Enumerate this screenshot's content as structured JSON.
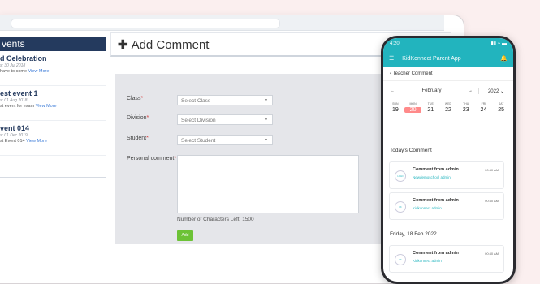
{
  "events": {
    "header": "vents",
    "items": [
      {
        "title": "d Celebration",
        "date": "s: 30 Jul 2018",
        "desc": "have to come",
        "more": "View More"
      },
      {
        "title": "est event 1",
        "date": "s: 01 Aug 2018",
        "desc": "st event for exam",
        "more": "View More"
      },
      {
        "title": "vent 014",
        "date": "s: 01 Dec 2019",
        "desc": "st Event 014",
        "more": "View More"
      }
    ]
  },
  "add_comment": {
    "title": "Add Comment",
    "fields": {
      "class_label": "Class",
      "class_value": "Select Class",
      "division_label": "Division",
      "division_value": "Select Division",
      "student_label": "Student",
      "student_value": "Select Student",
      "comment_label": "Personal comment"
    },
    "chars_left": "Number of Characters Left: 1500",
    "add_label": "Add"
  },
  "phone": {
    "time": "4:20",
    "signal": "▮▮ ⌁ ▬",
    "app_title": "KidKonnect Parent App",
    "subtitle": "Teacher Comment",
    "month": "February",
    "year": "2022",
    "days": [
      {
        "name": "SUN",
        "num": "19"
      },
      {
        "name": "MON",
        "num": "20",
        "selected": true
      },
      {
        "name": "TUE",
        "num": "21"
      },
      {
        "name": "WED",
        "num": "22"
      },
      {
        "name": "THU",
        "num": "23"
      },
      {
        "name": "FRI",
        "num": "24"
      },
      {
        "name": "SAT",
        "num": "25"
      }
    ],
    "today_label": "Today's Comment",
    "cards": [
      {
        "title": "Comment from admin",
        "sub": "Newdemoschool admin",
        "time": "00:40 AM",
        "logo": "LOGO"
      },
      {
        "title": "Comment from admin",
        "sub": "Kidkonnect admin",
        "time": "00:40 AM",
        "logo": "KK"
      }
    ],
    "date_label": "Friday, 18 Feb 2022",
    "card3": {
      "title": "Comment from admin",
      "sub": "Kidkonnect admin",
      "time": "00:40 AM",
      "logo": "KK"
    }
  }
}
